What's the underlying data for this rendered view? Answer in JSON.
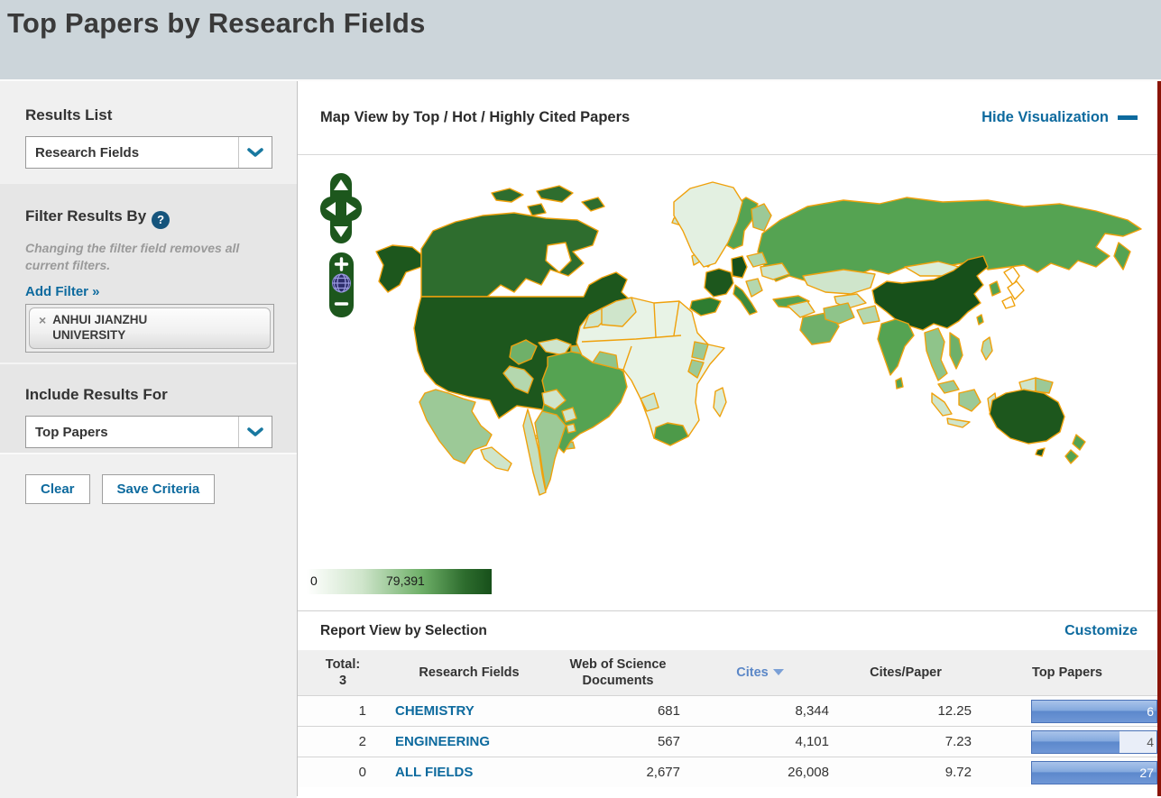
{
  "page": {
    "title": "Top Papers by Research Fields"
  },
  "sidebar": {
    "results_list": {
      "heading": "Results List",
      "dropdown_value": "Research Fields"
    },
    "filter": {
      "heading": "Filter Results By",
      "note": "Changing the filter field removes all current filters.",
      "add_filter_label": "Add Filter »",
      "chip": {
        "remove_glyph": "×",
        "label": "ANHUI JIANZHU UNIVERSITY"
      }
    },
    "include": {
      "heading": "Include Results For",
      "dropdown_value": "Top Papers"
    },
    "actions": {
      "clear_label": "Clear",
      "save_label": "Save Criteria"
    }
  },
  "map_panel": {
    "title": "Map View by Top / Hot / Highly Cited Papers",
    "hide_link_label": "Hide Visualization",
    "legend": {
      "min_label": "0",
      "max_label": "79,391"
    },
    "choropleth": {
      "low_color": "#ffffff",
      "high_color": "#17501a",
      "border_color": "#efa10c",
      "country_shading": {
        "china": "highest",
        "usa": "very-high",
        "australia": "very-high",
        "germany": "very-high",
        "france": "very-high",
        "canada": "high",
        "russia": "medium",
        "brazil": "medium",
        "india": "medium",
        "uk": "medium",
        "mexico": "low-medium",
        "greenland": "very-low",
        "africa_most": "low",
        "japan": "none"
      }
    }
  },
  "report": {
    "title": "Report View by Selection",
    "customize_label": "Customize",
    "header": {
      "total_label": "Total:",
      "total_value": "3",
      "col_field": "Research Fields",
      "col_docs": "Web of Science Documents",
      "col_cites": "Cites",
      "col_cpp": "Cites/Paper",
      "col_top": "Top Papers",
      "sorted_column": "Cites"
    },
    "rows": [
      {
        "rank": "1",
        "field": "CHEMISTRY",
        "docs": "681",
        "cites": "8,344",
        "cpp": "12.25",
        "top": "6",
        "bar_pct": 100
      },
      {
        "rank": "2",
        "field": "ENGINEERING",
        "docs": "567",
        "cites": "4,101",
        "cpp": "7.23",
        "top": "4",
        "bar_pct": 70
      },
      {
        "rank": "0",
        "field": "ALL FIELDS",
        "docs": "2,677",
        "cites": "26,008",
        "cpp": "9.72",
        "top": "27",
        "bar_pct": 100
      }
    ]
  },
  "colors": {
    "header_bg": "#ccd5da",
    "link_teal": "#0d6a9e",
    "sorted_header_blue": "#5b87c7",
    "bar_fill_blue": "#6f97d6",
    "edge_strip_red": "#8a1407"
  }
}
